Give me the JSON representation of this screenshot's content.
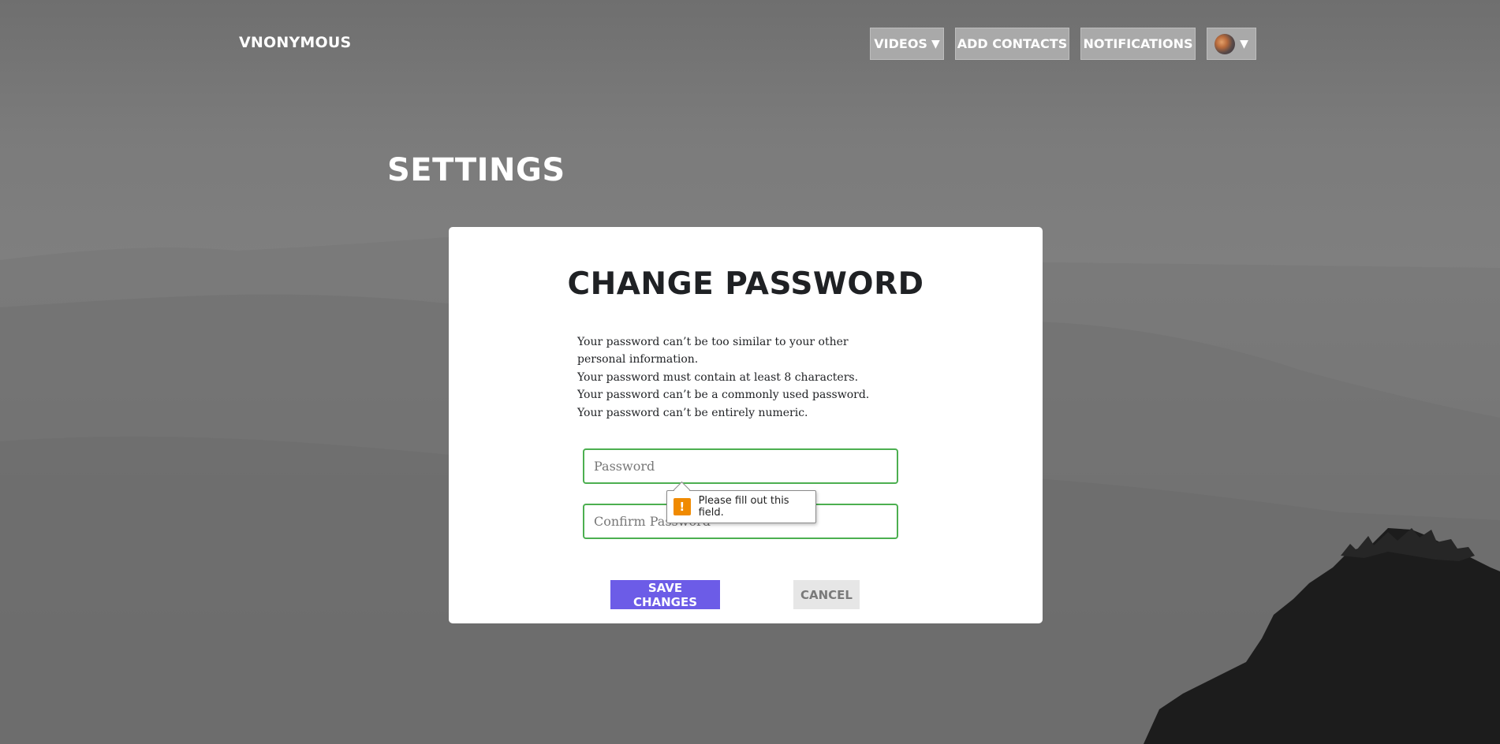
{
  "nav": {
    "brand": "VNONYMOUS",
    "videos_label": "VIDEOS",
    "add_contacts_label": "ADD CONTACTS",
    "notifications_label": "NOTIFICATIONS",
    "caret": "▼"
  },
  "page": {
    "title": "SETTINGS"
  },
  "form": {
    "title": "CHANGE PASSWORD",
    "help": [
      "Your password can’t be too similar to your other personal information.",
      "Your password must contain at least 8 characters.",
      "Your password can’t be a commonly used password.",
      "Your password can’t be entirely numeric."
    ],
    "password_placeholder": "Password",
    "confirm_placeholder": "Confirm Password",
    "save_label": "SAVE CHANGES",
    "cancel_label": "CANCEL"
  },
  "validation": {
    "icon": "!",
    "message": "Please fill out this field."
  },
  "colors": {
    "accent": "#6c5ce7",
    "field_border": "#4caf50",
    "warning": "#f08a00"
  },
  "icons": {
    "avatar": "user-avatar",
    "warning": "warning-icon"
  }
}
